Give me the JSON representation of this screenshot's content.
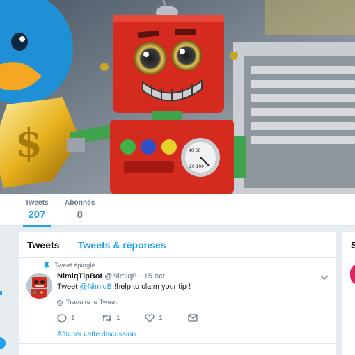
{
  "profile_nav": {
    "tweets_label": "Tweets",
    "tweets_count": "207",
    "followers_label": "Abonnés",
    "followers_count": "8"
  },
  "timeline": {
    "tabs": [
      "Tweets",
      "Tweets & réponses"
    ],
    "tweet": {
      "pinned_label": "Tweet épinglé",
      "name": "NimiqTipBot",
      "handle": "@NimiqB",
      "separator": "·",
      "date": "15 oct.",
      "mention": "@NimiqB",
      "text_before": "Tweet ",
      "text_after": " !help to claim your tip !",
      "translate_label": "Traduire le Tweet",
      "reply_count": "1",
      "retweet_count": "1",
      "like_count": "1",
      "thread_link": "Afficher cette discussion"
    }
  },
  "sidebar": {
    "title_fragment": "S"
  },
  "colors": {
    "accent": "#1da1f2",
    "muted": "#657786",
    "robot_red": "#d42b1e",
    "bird_blue": "#1f8fd6",
    "coin_gold": "#e7b21d"
  },
  "icons": [
    "pin-icon",
    "chevron-down-icon",
    "globe-icon",
    "reply-icon",
    "retweet-icon",
    "heart-icon",
    "envelope-icon"
  ]
}
